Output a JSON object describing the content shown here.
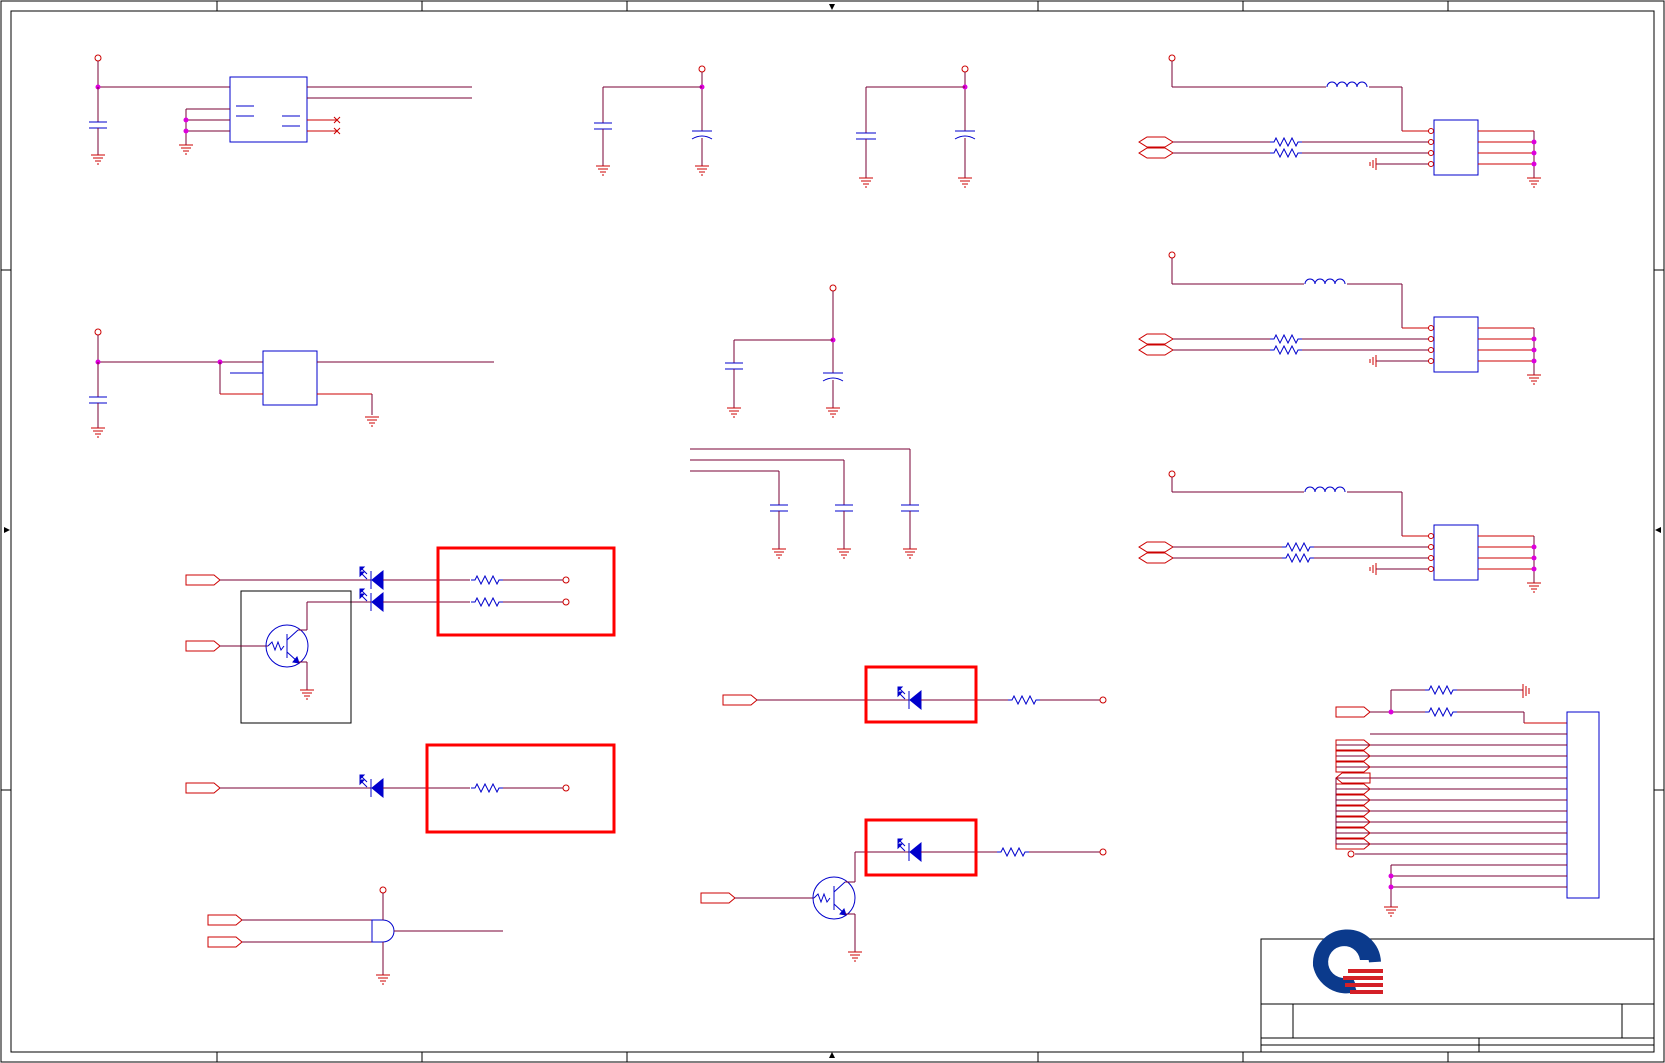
{
  "colors": {
    "wire": "#cc0000",
    "net": "#7a0035",
    "component": "#0000cc",
    "junction": "#dd00dd",
    "highlight": "#ff0000",
    "frame": "#000000",
    "logo_blue": "#0b3a8c",
    "logo_red": "#d42027"
  },
  "title_block": {
    "logo": "company-logo",
    "fields": [
      "",
      "",
      "",
      ""
    ]
  }
}
